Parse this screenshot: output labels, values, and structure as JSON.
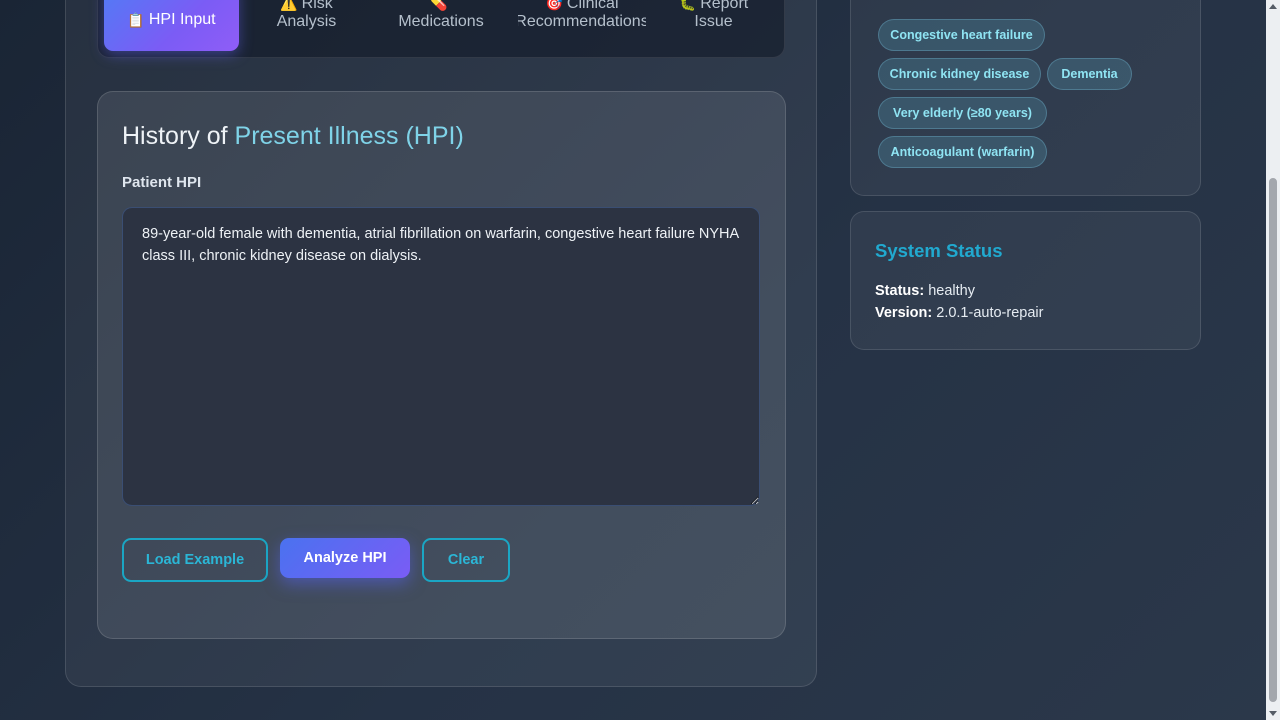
{
  "tabs": [
    {
      "icon": "📋",
      "label": "HPI Input",
      "active": true
    },
    {
      "icon": "⚠️",
      "label_line1": "Risk",
      "label_line2": "Analysis"
    },
    {
      "icon": "💊",
      "label": "Medications"
    },
    {
      "icon": "🎯",
      "label_line1": "Clinical",
      "label_line2": "Recommendations"
    },
    {
      "icon": "🐛",
      "label_line1": "Report",
      "label_line2": "Issue"
    }
  ],
  "hpi_card": {
    "title_prefix": "History of ",
    "title_accent": "Present Illness (HPI)",
    "field_label": "Patient HPI",
    "hpi_value": "89-year-old female with dementia, atrial fibrillation on warfarin, congestive heart failure NYHA class III, chronic kidney disease on dialysis.",
    "buttons": {
      "load_example": "Load Example",
      "analyze": "Analyze HPI",
      "clear": "Clear"
    }
  },
  "risk_factors": [
    "Congestive heart failure",
    "Chronic kidney disease",
    "Dementia",
    "Very elderly (≥80 years)",
    "Anticoagulant (warfarin)"
  ],
  "system_status": {
    "title": "System Status",
    "status_label": "Status:",
    "status_value": "healthy",
    "version_label": "Version:",
    "version_value": "2.0.1-auto-repair"
  },
  "colors": {
    "accent_cyan": "#21a9cf",
    "primary_gradient_start": "#4a72f0",
    "primary_gradient_end": "#7a5cf5",
    "pill_text": "#8fe4f3"
  }
}
